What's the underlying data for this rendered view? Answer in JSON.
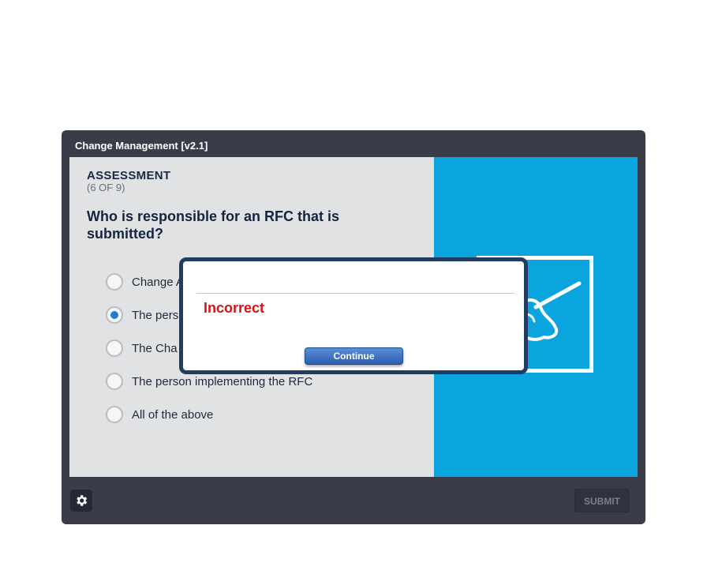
{
  "player": {
    "title": "Change Management [v2.1]",
    "submit_label": "SUBMIT",
    "settings_icon": "gear-icon"
  },
  "slide": {
    "heading": "ASSESSMENT",
    "progress": "(6 OF 9)",
    "question": "Who is responsible for an RFC that is submitted?",
    "options": [
      {
        "label": "Change A",
        "selected": false
      },
      {
        "label": "The pers",
        "selected": true
      },
      {
        "label": "The Cha",
        "selected": false
      },
      {
        "label": "The person implementing the RFC",
        "selected": false
      },
      {
        "label": "All of the above",
        "selected": false
      }
    ],
    "illustration_icon": "hand-writing-board-icon",
    "panel_color": "#0aa5df"
  },
  "dialog": {
    "result": "Incorrect",
    "continue_label": "Continue",
    "result_color": "#d11515",
    "border_color": "#213c63"
  }
}
